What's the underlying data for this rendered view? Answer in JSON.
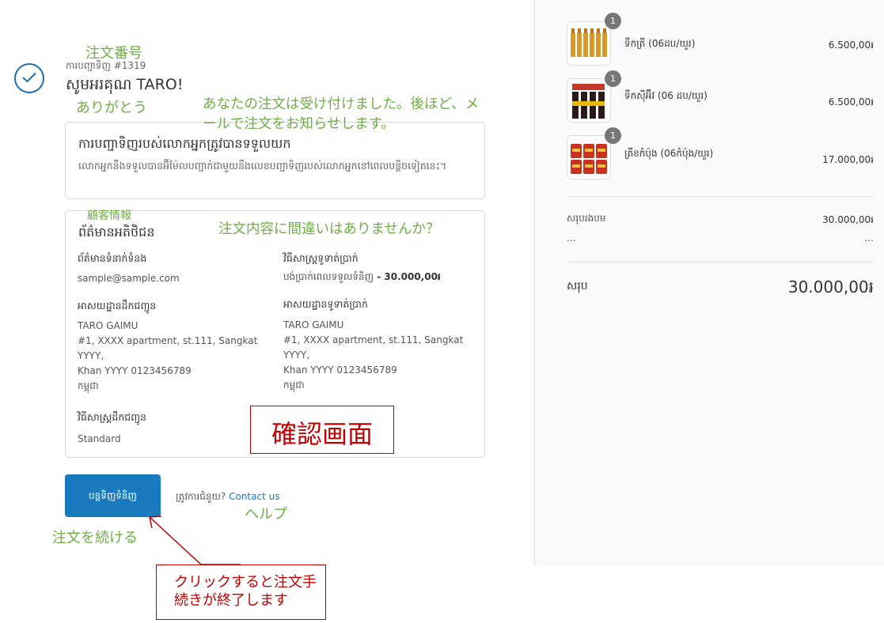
{
  "order": {
    "number_label": "ការបញ្ជាទិញ #1319",
    "thanks": "សូមអរគុណ TARO!"
  },
  "confirmation_box": {
    "title": "ការបញ្ជាទិញរបស់លោកអ្នកត្រូវបានទទួលយក",
    "text": "លោកអ្នកនឹងទទួលបានអ៊ីម៉ែលបញ្ជាក់ជាមួយនឹងលេខបញ្ជាទិញរបស់លោកអ្នកនៅពេលបន្តិចទៀតនេះ។"
  },
  "customer_info": {
    "title": "ព័ត៌មានអតិថិជន",
    "contact": {
      "heading": "ព័ត៌មានទំនាក់ទំនង",
      "value": "sample@sample.com"
    },
    "payment_method": {
      "heading": "វិធីសាស្ត្រទូទាត់ប្រាក់",
      "value": "បង់ប្រាក់ពេលទទួលទំនិញ",
      "amount": " - 30.000,00៛"
    },
    "shipping_address": {
      "heading": "អាសយដ្ឋានដឹកជញ្ជូន",
      "lines": [
        "TARO GAIMU",
        "#1, XXXX apartment, st.111, Sangkat",
        "YYYY,",
        "Khan YYYY 0123456789",
        "កម្ពុជា"
      ]
    },
    "billing_address": {
      "heading": "អាសយដ្ឋានទូទាត់ប្រាក់",
      "lines": [
        "TARO GAIMU",
        "#1, XXXX apartment, st.111, Sangkat",
        "YYYY,",
        "Khan YYYY 0123456789",
        "កម្ពុជា"
      ]
    },
    "shipping_method": {
      "heading": "វិធីសាស្ត្រដឹកជញ្ជូន",
      "value": "Standard"
    }
  },
  "actions": {
    "continue_button": "បន្តទិញទំនិញ",
    "help_prefix": "ត្រូវការជំនួយ?",
    "help_link": "Contact us"
  },
  "cart": {
    "items": [
      {
        "name": "ទឹកត្រី (06ដប/យួរ)",
        "price": "6.500,00៛",
        "quantity": "1"
      },
      {
        "name": "ទឹកស៊ីអ៊ីវ (06 ដប/យួរ)",
        "price": "6.500,00៛",
        "quantity": "1"
      },
      {
        "name": "ត្រីខកំប៉ុង (06កំប៉ុង/យួរ)",
        "price": "17.000,00៛",
        "quantity": "1"
      }
    ],
    "subtotal_label": "សរុបរងបម",
    "subtotal_value": "30.000,00៛",
    "shipping_label": "...",
    "shipping_value": "...",
    "total_label": "សរុប",
    "total_value": "30.000,00៛"
  },
  "annotations": {
    "order_number": "注文番号",
    "thank_you": "ありがとう",
    "accepted": "あなたの注文は受け付けました。後ほど、メールで注文をお知らせします。",
    "customer_info": "顧客情報",
    "check_order": "注文内容に間違いはありませんか？",
    "confirm_screen": "確認画面",
    "continue": "注文を続ける",
    "help": "ヘルプ",
    "click_note": "クリックすると注文手続きが終了します"
  },
  "colors": {
    "accent": "#197bbd",
    "annotation_green": "#70ad47",
    "annotation_red": "#c00000"
  }
}
